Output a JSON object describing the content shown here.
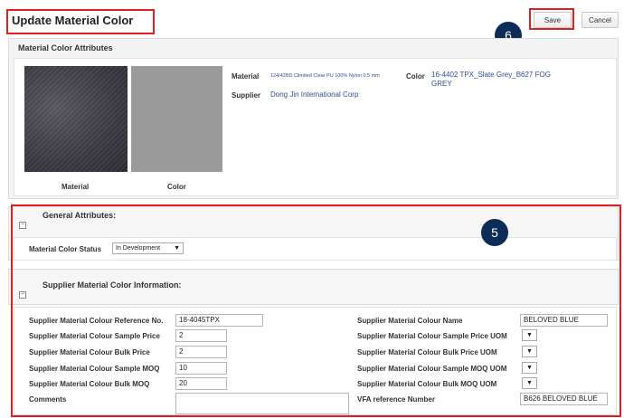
{
  "page": {
    "title": "Update Material Color",
    "save_label": "Save",
    "cancel_label": "Cancel",
    "badge_save": "6",
    "badge_section": "5"
  },
  "attributes": {
    "heading": "Material Color Attributes",
    "material_caption": "Material",
    "color_caption": "Color",
    "material_label": "Material",
    "material_value": "124/42BD Climited Clear PU 100% Nylon 0.5 mm",
    "color_label": "Color",
    "color_value": "16-4402 TPX_Slate Grey_B627 FOG GREY",
    "supplier_label": "Supplier",
    "supplier_value": "Dong Jin International Corp"
  },
  "general": {
    "heading": "General Attributes:",
    "status_label": "Material Color Status",
    "status_value": "In Development",
    "status_arrow": "▼"
  },
  "supplier": {
    "heading": "Supplier Material Color Information:",
    "left": [
      {
        "label": "Supplier Material Colour Reference No.",
        "value": "18-4045TPX"
      },
      {
        "label": "Supplier Material Colour Sample Price",
        "value": "2"
      },
      {
        "label": "Supplier Material Colour Bulk Price",
        "value": "2"
      },
      {
        "label": "Supplier Material Colour Sample MOQ",
        "value": "10"
      },
      {
        "label": "Supplier Material Colour Bulk MOQ",
        "value": "20"
      },
      {
        "label": "Comments",
        "value": ""
      }
    ],
    "right": [
      {
        "label": "Supplier Material Colour Name",
        "value": "BELOVED BLUE"
      },
      {
        "label": "Supplier Material Colour Sample Price UOM",
        "value": "▼"
      },
      {
        "label": "Supplier Material Colour Bulk Price UOM",
        "value": "▼"
      },
      {
        "label": "Supplier Material Colour Sample MOQ UOM",
        "value": "▼"
      },
      {
        "label": "Supplier Material Colour Bulk MOQ UOM",
        "value": "▼"
      },
      {
        "label": "VFA reference Number",
        "value": "B626 BELOVED BLUE"
      }
    ]
  },
  "colors": {
    "highlight_red": "#e02020",
    "badge_navy": "#0d2c57",
    "link_blue": "#2b4f96"
  }
}
